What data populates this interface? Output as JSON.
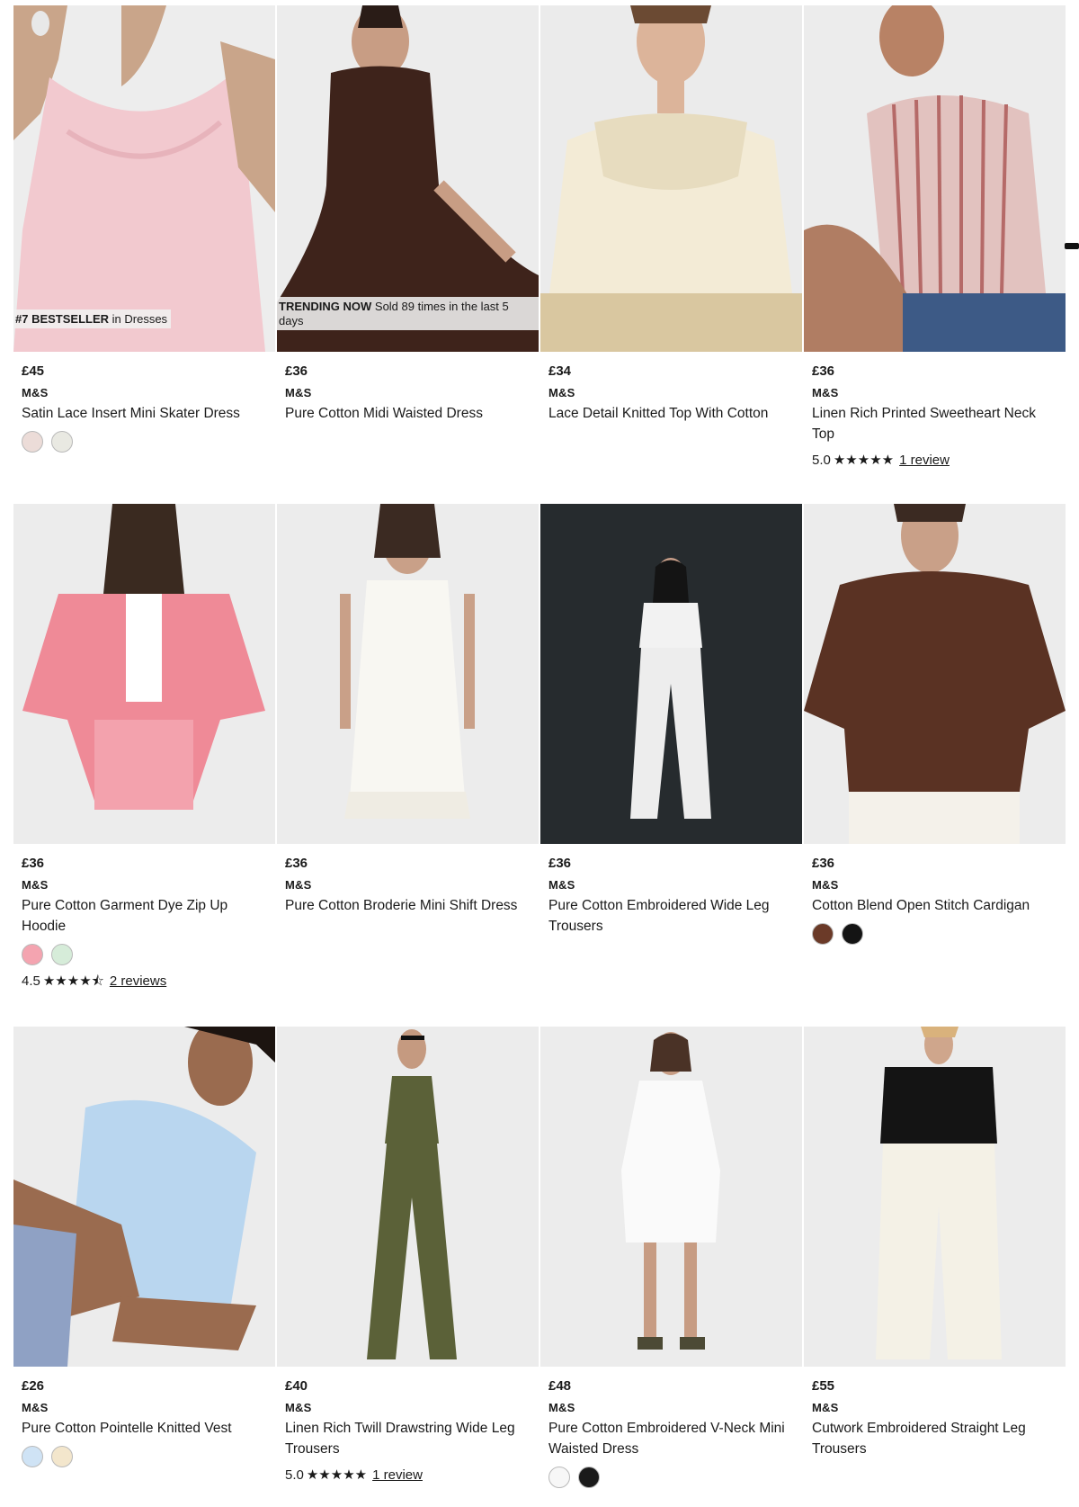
{
  "products": [
    {
      "price": "£45",
      "brand": "M&S",
      "name": "Satin Lace Insert Mini Skater Dress",
      "badge_bold": "#7 BESTSELLER",
      "badge_text": " in Dresses",
      "swatches": [
        "#ecdcd8",
        "#e9e9e2"
      ]
    },
    {
      "price": "£36",
      "brand": "M&S",
      "name": "Pure Cotton Midi Waisted Dress",
      "badge_bold": "TRENDING NOW",
      "badge_text": " Sold 89 times in the last 5 days"
    },
    {
      "price": "£34",
      "brand": "M&S",
      "name": "Lace Detail Knitted Top With Cotton"
    },
    {
      "price": "£36",
      "brand": "M&S",
      "name": "Linen Rich Printed Sweetheart Neck Top",
      "rating_value": "5.0",
      "rating_stars": "★★★★★",
      "rating_link": "1 review"
    },
    {
      "price": "£36",
      "brand": "M&S",
      "name": "Pure Cotton Garment Dye Zip Up Hoodie",
      "swatches": [
        "#f4a4b0",
        "#d6ecd9"
      ],
      "rating_value": "4.5",
      "rating_stars": "★★★★⯪",
      "rating_link": "2 reviews"
    },
    {
      "price": "£36",
      "brand": "M&S",
      "name": "Pure Cotton Broderie Mini Shift Dress"
    },
    {
      "price": "£36",
      "brand": "M&S",
      "name": "Pure Cotton Embroidered Wide Leg Trousers"
    },
    {
      "price": "£36",
      "brand": "M&S",
      "name": "Cotton Blend Open Stitch Cardigan",
      "swatches": [
        "#6b3a28",
        "#141414"
      ]
    },
    {
      "price": "£26",
      "brand": "M&S",
      "name": "Pure Cotton Pointelle Knitted Vest",
      "swatches": [
        "#cfe3f5",
        "#f3e6cc"
      ]
    },
    {
      "price": "£40",
      "brand": "M&S",
      "name": "Linen Rich Twill Drawstring Wide Leg Trousers",
      "rating_value": "5.0",
      "rating_stars": "★★★★★",
      "rating_link": "1 review"
    },
    {
      "price": "£48",
      "brand": "M&S",
      "name": "Pure Cotton Embroidered V-Neck Mini Waisted Dress",
      "swatches": [
        "#f7f7f7",
        "#1a1a1a"
      ]
    },
    {
      "price": "£55",
      "brand": "M&S",
      "name": "Cutwork Embroidered Straight Leg Trousers"
    }
  ]
}
